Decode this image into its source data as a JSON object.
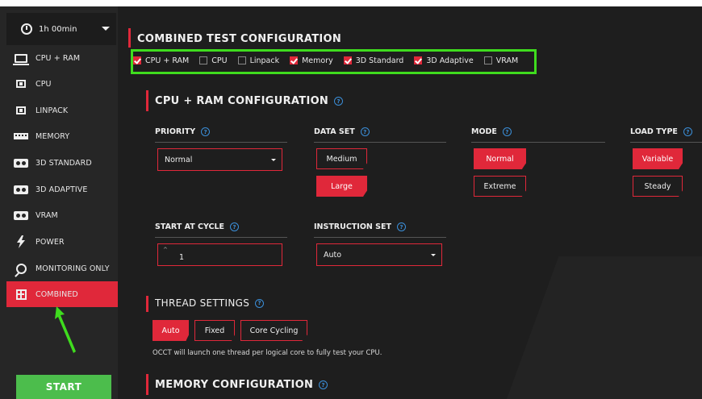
{
  "sidebar": {
    "timer_label": "1h 00min",
    "items": [
      {
        "label": "CPU + RAM",
        "icon": "monitor-icon"
      },
      {
        "label": "CPU",
        "icon": "cpu-icon"
      },
      {
        "label": "LINPACK",
        "icon": "linpack-icon"
      },
      {
        "label": "MEMORY",
        "icon": "memory-icon"
      },
      {
        "label": "3D STANDARD",
        "icon": "gpu-icon"
      },
      {
        "label": "3D ADAPTIVE",
        "icon": "gpu-icon"
      },
      {
        "label": "VRAM",
        "icon": "gpu-icon"
      },
      {
        "label": "POWER",
        "icon": "lightning-icon"
      },
      {
        "label": "MONITORING ONLY",
        "icon": "search-icon"
      },
      {
        "label": "COMBINED",
        "icon": "plus-box-icon"
      }
    ],
    "active_item": "COMBINED",
    "start_label": "START"
  },
  "main": {
    "combined_title": "COMBINED TEST CONFIGURATION",
    "tests": [
      {
        "label": "CPU + RAM",
        "checked": true
      },
      {
        "label": "CPU",
        "checked": false
      },
      {
        "label": "Linpack",
        "checked": false
      },
      {
        "label": "Memory",
        "checked": true
      },
      {
        "label": "3D Standard",
        "checked": true
      },
      {
        "label": "3D Adaptive",
        "checked": true
      },
      {
        "label": "VRAM",
        "checked": false
      }
    ],
    "cpu_ram_title": "CPU + RAM CONFIGURATION",
    "priority": {
      "label": "PRIORITY",
      "value": "Normal"
    },
    "data_set": {
      "label": "DATA SET",
      "options": [
        "Medium",
        "Large"
      ],
      "selected": "Large"
    },
    "mode": {
      "label": "MODE",
      "options": [
        "Normal",
        "Extreme"
      ],
      "selected": "Normal"
    },
    "load_type": {
      "label": "LOAD TYPE",
      "options": [
        "Variable",
        "Steady"
      ],
      "selected": "Variable"
    },
    "start_cycle": {
      "label": "START AT CYCLE",
      "value": "1"
    },
    "instruction_set": {
      "label": "INSTRUCTION SET",
      "value": "Auto"
    },
    "thread_title": "THREAD SETTINGS",
    "thread_options": [
      "Auto",
      "Fixed",
      "Core Cycling"
    ],
    "thread_selected": "Auto",
    "thread_info": "OCCT will launch one thread per logical core to fully test your CPU.",
    "memory_title": "MEMORY CONFIGURATION"
  },
  "colors": {
    "accent": "#e0283a",
    "start": "#4cbd4c",
    "highlight": "#3fdc1e",
    "help": "#3b8fd9"
  }
}
